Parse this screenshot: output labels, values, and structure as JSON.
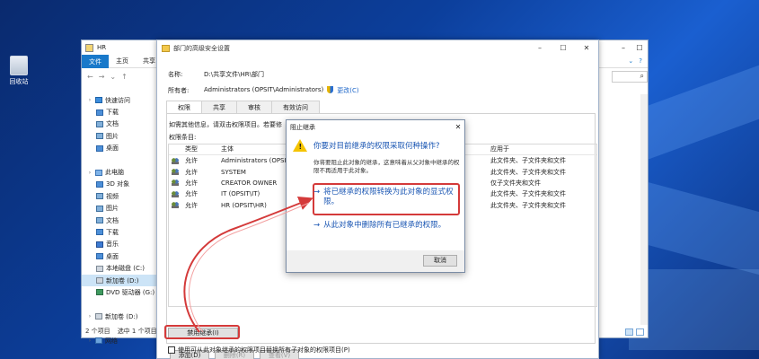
{
  "desktop": {
    "recycle_bin_label": "回收站"
  },
  "explorer": {
    "title": "HR",
    "ribbon_tabs": [
      "文件",
      "主页",
      "共享",
      "查看"
    ],
    "nav": [
      {
        "label": "快速访问",
        "icon": "star-icon",
        "chev": "›"
      },
      {
        "label": "下载",
        "icon": "download-icon"
      },
      {
        "label": "文档",
        "icon": "document-icon"
      },
      {
        "label": "图片",
        "icon": "pictures-icon"
      },
      {
        "label": "桌面",
        "icon": "desktop-icon"
      },
      {
        "label": "",
        "icon": ""
      },
      {
        "label": "此电脑",
        "icon": "pc-icon",
        "chev": "›"
      },
      {
        "label": "3D 对象",
        "icon": "3d-objects-icon"
      },
      {
        "label": "视频",
        "icon": "video-icon"
      },
      {
        "label": "图片",
        "icon": "pictures-icon"
      },
      {
        "label": "文档",
        "icon": "document-icon"
      },
      {
        "label": "下载",
        "icon": "download-icon"
      },
      {
        "label": "音乐",
        "icon": "music-icon"
      },
      {
        "label": "桌面",
        "icon": "desktop-icon"
      },
      {
        "label": "本地磁盘 (C:)",
        "icon": "drive-icon"
      },
      {
        "label": "新加卷 (D:)",
        "icon": "drive-icon",
        "selected": true
      },
      {
        "label": "DVD 驱动器 (G:)",
        "icon": "dvd-icon"
      },
      {
        "label": "",
        "icon": ""
      },
      {
        "label": "新加卷 (D:)",
        "icon": "drive-icon",
        "chev": "›"
      },
      {
        "label": "",
        "icon": ""
      },
      {
        "label": "网络",
        "icon": "network-icon",
        "chev": "›"
      }
    ],
    "status_count": "2 个项目",
    "status_selected": "选中 1 个项目"
  },
  "advanced": {
    "title": "部门的高级安全设置",
    "name_label": "名称:",
    "name_value": "D:\\共享文件\\HR\\部门",
    "owner_label": "所有者:",
    "owner_value": "Administrators (OPSIT\\Administrators)",
    "change_link": "更改(C)",
    "tabs": [
      "权限",
      "共享",
      "审核",
      "有效访问"
    ],
    "info_text": "如需其他信息，请双击权限项目。若要修",
    "entries_label": "权限条目:",
    "columns": [
      "类型",
      "主体",
      "应用于"
    ],
    "rows": [
      {
        "type": "允许",
        "principal": "Administrators (OPSIT\\Ad",
        "applies": "此文件夹、子文件夹和文件"
      },
      {
        "type": "允许",
        "principal": "SYSTEM",
        "applies": "此文件夹、子文件夹和文件"
      },
      {
        "type": "允许",
        "principal": "CREATOR OWNER",
        "applies": "仅子文件夹和文件"
      },
      {
        "type": "允许",
        "principal": "IT (OPSIT\\IT)",
        "applies": "此文件夹、子文件夹和文件"
      },
      {
        "type": "允许",
        "principal": "HR (OPSIT\\HR)",
        "applies": "此文件夹、子文件夹和文件"
      }
    ],
    "add_btn": "添加(D)",
    "remove_btn": "删除(R)",
    "view_btn": "查看(V)",
    "disable_inherit_btn": "禁用继承(I)",
    "replace_checkbox": "使用可从此对象继承的权限项目替换所有子对象的权限项目(P)"
  },
  "dialog": {
    "title": "阻止继承",
    "question": "你要对目前继承的权限采取何种操作?",
    "description": "你将要阻止此对象的继承，这意味着从父对象中继承的权限不再适用于此对象。",
    "option1": "将已继承的权限转换为此对象的显式权限。",
    "option2": "从此对象中删除所有已继承的权限。",
    "arrow": "→",
    "cancel": "取消",
    "warning_mark": "!"
  },
  "colors": {
    "accent": "#1979ca",
    "link": "#1a56b3",
    "highlight": "#d43a3a"
  }
}
